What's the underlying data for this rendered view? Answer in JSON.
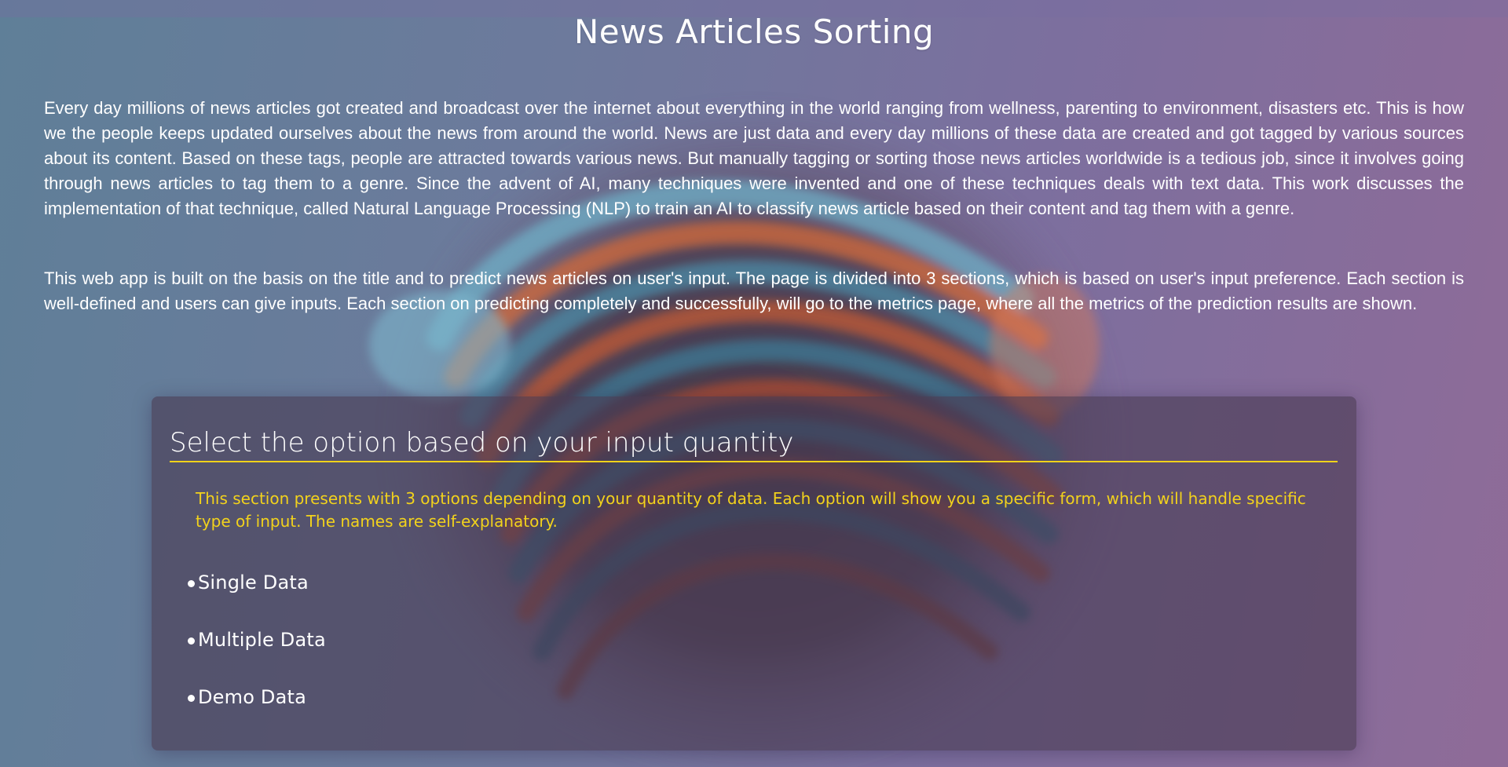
{
  "page": {
    "title": "News Articles Sorting",
    "paragraphs": [
      "Every day millions of news articles got created and broadcast over the internet about everything in the world ranging from wellness, parenting to environment, disasters etc. This is how we the people keeps updated ourselves about the news from around the world. News are just data and every day millions of these data are created and got tagged by various sources about its content. Based on these tags, people are attracted towards various news. But manually tagging or sorting those news articles worldwide is a tedious job, since it involves going through news articles to tag them to a genre. Since the advent of AI, many techniques were invented and one of these techniques deals with text data. This work discusses the implementation of that technique, called Natural Language Processing (NLP) to train an AI to classify news article based on their content and tag them with a genre.",
      "This web app is built on the basis on the title and to predict news articles on user's input. The page is divided into 3 sections, which is based on user's input preference. Each section is well-defined and users can give inputs. Each section on predicting completely and successfully, will go to the metrics page, where all the metrics of the prediction results are shown."
    ]
  },
  "panel": {
    "heading": "Select the option based on your input quantity",
    "description": "This section presents with 3 options depending on your quantity of data. Each option will show you a specific form, which will handle specific type of input. The names are self-explanatory.",
    "options": [
      {
        "label": "Single Data"
      },
      {
        "label": "Multiple Data"
      },
      {
        "label": "Demo Data"
      }
    ]
  },
  "colors": {
    "accent": "#f2d21c",
    "text": "#ffffff",
    "panel_bg": "#483a52"
  }
}
